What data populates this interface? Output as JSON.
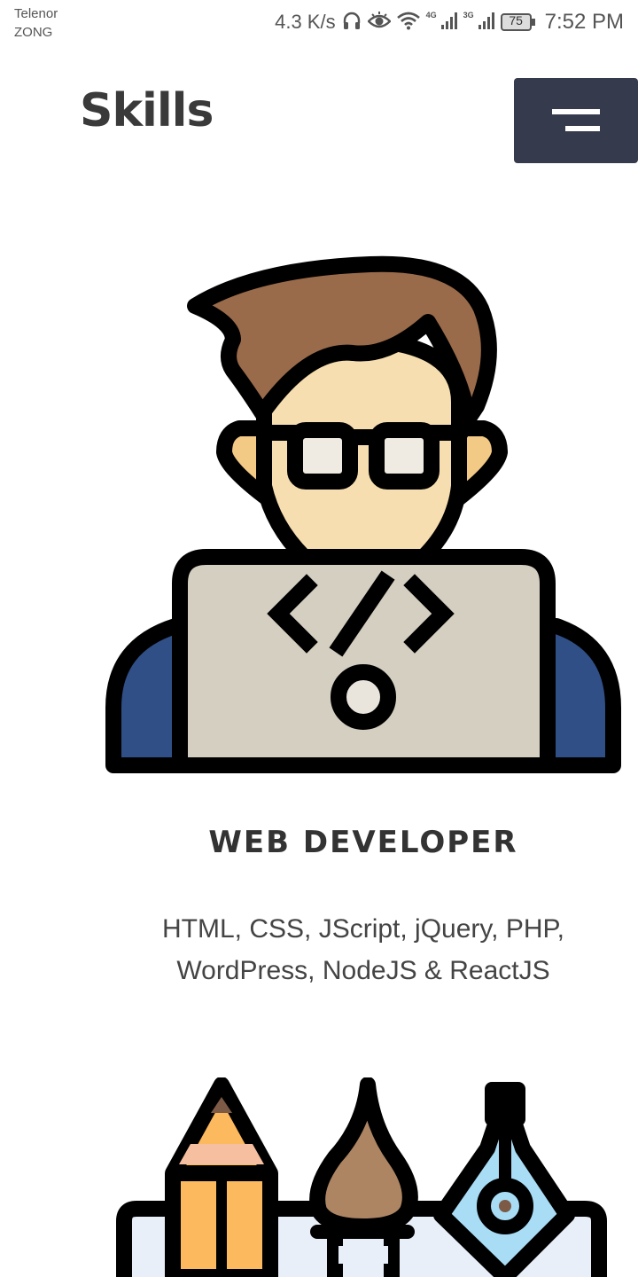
{
  "status_bar": {
    "carrier_1": "Telenor",
    "carrier_2": "ZONG",
    "speed": "4.3 K/s",
    "sig1_label": "4G",
    "sig2_label": "3G",
    "battery": "75",
    "time": "7:52 PM",
    "icons": [
      "headphones-icon",
      "eye-icon",
      "wifi-icon",
      "signal-icon",
      "signal-icon",
      "battery-icon"
    ]
  },
  "header": {
    "title": "Skills",
    "menu_icon": "hamburger-menu-icon",
    "menu_color": "#363a4d"
  },
  "skills": [
    {
      "illustration": "web-developer-illustration",
      "title": "WEB DEVELOPER",
      "description": "HTML, CSS, JScript, jQuery, PHP, WordPress, NodeJS & ReactJS"
    },
    {
      "illustration": "design-tools-illustration"
    }
  ]
}
